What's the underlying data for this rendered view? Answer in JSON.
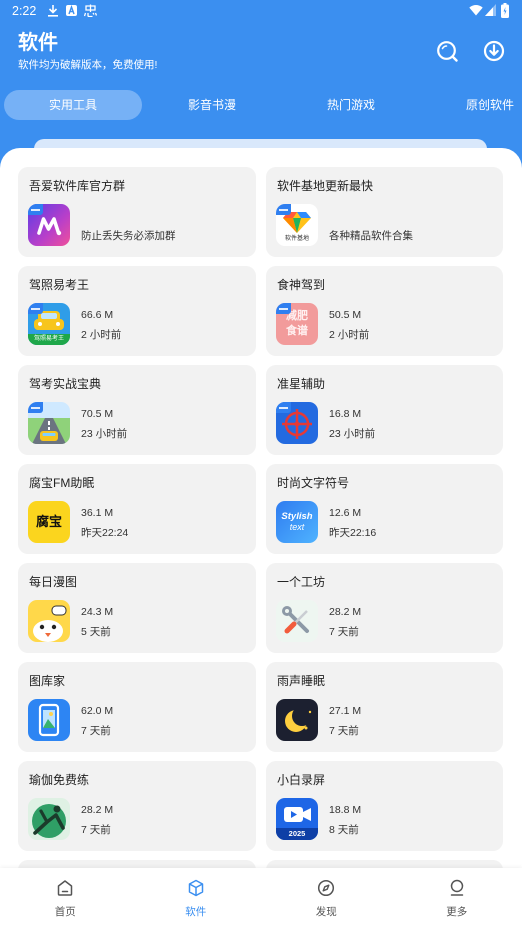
{
  "status_bar": {
    "time": "2:22",
    "icons": [
      "download-icon",
      "a-icon",
      "notification-icon",
      "wifi-icon",
      "signal-icon",
      "battery-icon"
    ]
  },
  "header": {
    "title": "软件",
    "subtitle": "软件均为破解版本，免费使用!",
    "actions": [
      "search-icon",
      "download-icon"
    ]
  },
  "tabs": [
    {
      "label": "实用工具",
      "selected": true
    },
    {
      "label": "影音书漫",
      "selected": false
    },
    {
      "label": "热门游戏",
      "selected": false
    },
    {
      "label": "原创软件",
      "selected": false
    }
  ],
  "apps": [
    {
      "name": "吾爱软件库官方群",
      "desc": "防止丢失务必添加群",
      "icon": "wuai-logo-icon",
      "tag": true
    },
    {
      "name": "软件基地更新最快",
      "desc": "各种精品软件合集",
      "icon": "diamond-logo-icon",
      "icon_text": "软件基地",
      "tag": true
    },
    {
      "name": "驾照易考王",
      "size": "66.6 M",
      "time": "2 小时前",
      "icon": "car-icon",
      "icon_text": "驾照易考王",
      "tag": true
    },
    {
      "name": "食神驾到",
      "size": "50.5 M",
      "time": "2 小时前",
      "icon": "recipe-icon",
      "icon_text": [
        "减肥",
        "食谱"
      ],
      "tag": true
    },
    {
      "name": "驾考实战宝典",
      "size": "70.5 M",
      "time": "23 小时前",
      "icon": "road-car-icon",
      "tag": true
    },
    {
      "name": "准星辅助",
      "size": "16.8 M",
      "time": "23 小时前",
      "icon": "crosshair-icon",
      "tag": true
    },
    {
      "name": "腐宝FM助眠",
      "size": "36.1 M",
      "time": "昨天22:24",
      "icon": "fubao-logo-icon",
      "icon_text": "腐宝"
    },
    {
      "name": "时尚文字符号",
      "size": "12.6 M",
      "time": "昨天22:16",
      "icon": "stylish-text-icon",
      "icon_text": [
        "Stylish",
        "text"
      ]
    },
    {
      "name": "每日漫图",
      "size": "24.3 M",
      "time": "5 天前",
      "icon": "cartoon-face-icon"
    },
    {
      "name": "一个工坊",
      "size": "28.2 M",
      "time": "7 天前",
      "icon": "tools-icon"
    },
    {
      "name": "图库家",
      "size": "62.0 M",
      "time": "7 天前",
      "icon": "gallery-phone-icon"
    },
    {
      "name": "雨声睡眠",
      "size": "27.1 M",
      "time": "7 天前",
      "icon": "moon-icon"
    },
    {
      "name": "瑜伽免费练",
      "size": "28.2 M",
      "time": "7 天前",
      "icon": "yoga-icon"
    },
    {
      "name": "小白录屏",
      "size": "18.8 M",
      "time": "8 天前",
      "icon": "video-camera-icon",
      "icon_text": "2025"
    }
  ],
  "bottom_nav": [
    {
      "label": "首页",
      "icon": "home-icon",
      "selected": false
    },
    {
      "label": "软件",
      "icon": "cube-icon",
      "selected": true
    },
    {
      "label": "发现",
      "icon": "compass-icon",
      "selected": false
    },
    {
      "label": "更多",
      "icon": "user-icon",
      "selected": false
    }
  ],
  "colors": {
    "primary": "#3b8ff0",
    "tab_selected": "#76b1f6",
    "card_bg": "#f2f2f2",
    "text": "#222222",
    "nav_inactive": "#555555"
  }
}
